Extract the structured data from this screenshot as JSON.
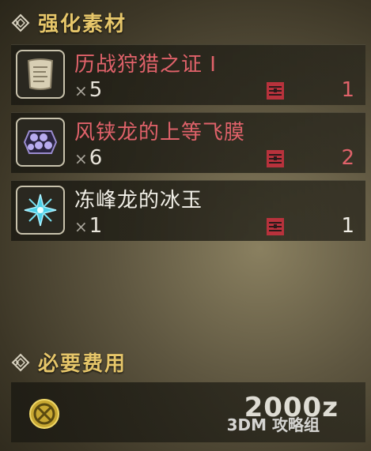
{
  "section_materials": {
    "title": "强化素材",
    "items": [
      {
        "name": "历战狩猎之证 Ⅰ",
        "name_color": "red",
        "qty_prefix": "×",
        "qty": "5",
        "owned": "1",
        "owned_color": "red",
        "icon": "parchment-icon"
      },
      {
        "name": "风铗龙的上等飞膜",
        "name_color": "red",
        "qty_prefix": "×",
        "qty": "6",
        "owned": "2",
        "owned_color": "red",
        "icon": "wing-membrane-icon"
      },
      {
        "name": "冻峰龙的冰玉",
        "name_color": "white",
        "qty_prefix": "×",
        "qty": "1",
        "owned": "1",
        "owned_color": "white",
        "icon": "ice-gem-icon"
      }
    ],
    "box_icon": "item-box-icon"
  },
  "section_cost": {
    "title": "必要费用",
    "cost_icon": "zenny-coin-icon",
    "value": "2000z",
    "watermark": "3DM 攻略组"
  },
  "colors": {
    "header_gold": "#e6c66a",
    "warning_red": "#e0626a",
    "text_white": "#f2f0e8",
    "box_red": "#b8323c"
  }
}
